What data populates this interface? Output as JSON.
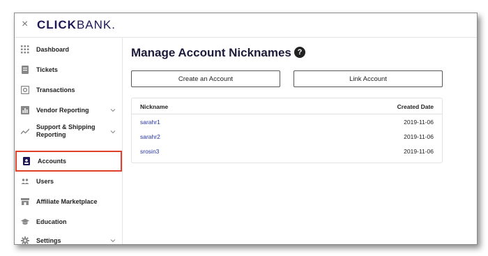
{
  "header": {
    "close_symbol": "×",
    "logo_bold": "CLICK",
    "logo_light": "BANK."
  },
  "sidebar": {
    "items": [
      {
        "label": "Dashboard",
        "icon": "grid-icon"
      },
      {
        "label": "Tickets",
        "icon": "ticket-icon"
      },
      {
        "label": "Transactions",
        "icon": "transactions-icon"
      },
      {
        "label": "Vendor Reporting",
        "icon": "bar-chart-icon"
      },
      {
        "label": "Support & Shipping Reporting",
        "icon": "line-chart-icon"
      },
      {
        "label": "Accounts",
        "icon": "id-badge-icon",
        "active": true
      },
      {
        "label": "Users",
        "icon": "users-icon"
      },
      {
        "label": "Affiliate Marketplace",
        "icon": "storefront-icon"
      },
      {
        "label": "Education",
        "icon": "graduation-cap-icon"
      },
      {
        "label": "Settings",
        "icon": "gear-icon"
      }
    ]
  },
  "main": {
    "title": "Manage Account Nicknames",
    "help_symbol": "?",
    "buttons": {
      "create": "Create an Account",
      "link": "Link Account"
    },
    "table": {
      "headers": {
        "nickname": "Nickname",
        "created": "Created Date"
      },
      "rows": [
        {
          "nickname": "sarahr1",
          "created": "2019-11-06"
        },
        {
          "nickname": "sarahr2",
          "created": "2019-11-06"
        },
        {
          "nickname": "srosin3",
          "created": "2019-11-06"
        }
      ]
    }
  },
  "colors": {
    "brand": "#1d1756",
    "link": "#2633a5",
    "highlight": "#e0402a"
  }
}
